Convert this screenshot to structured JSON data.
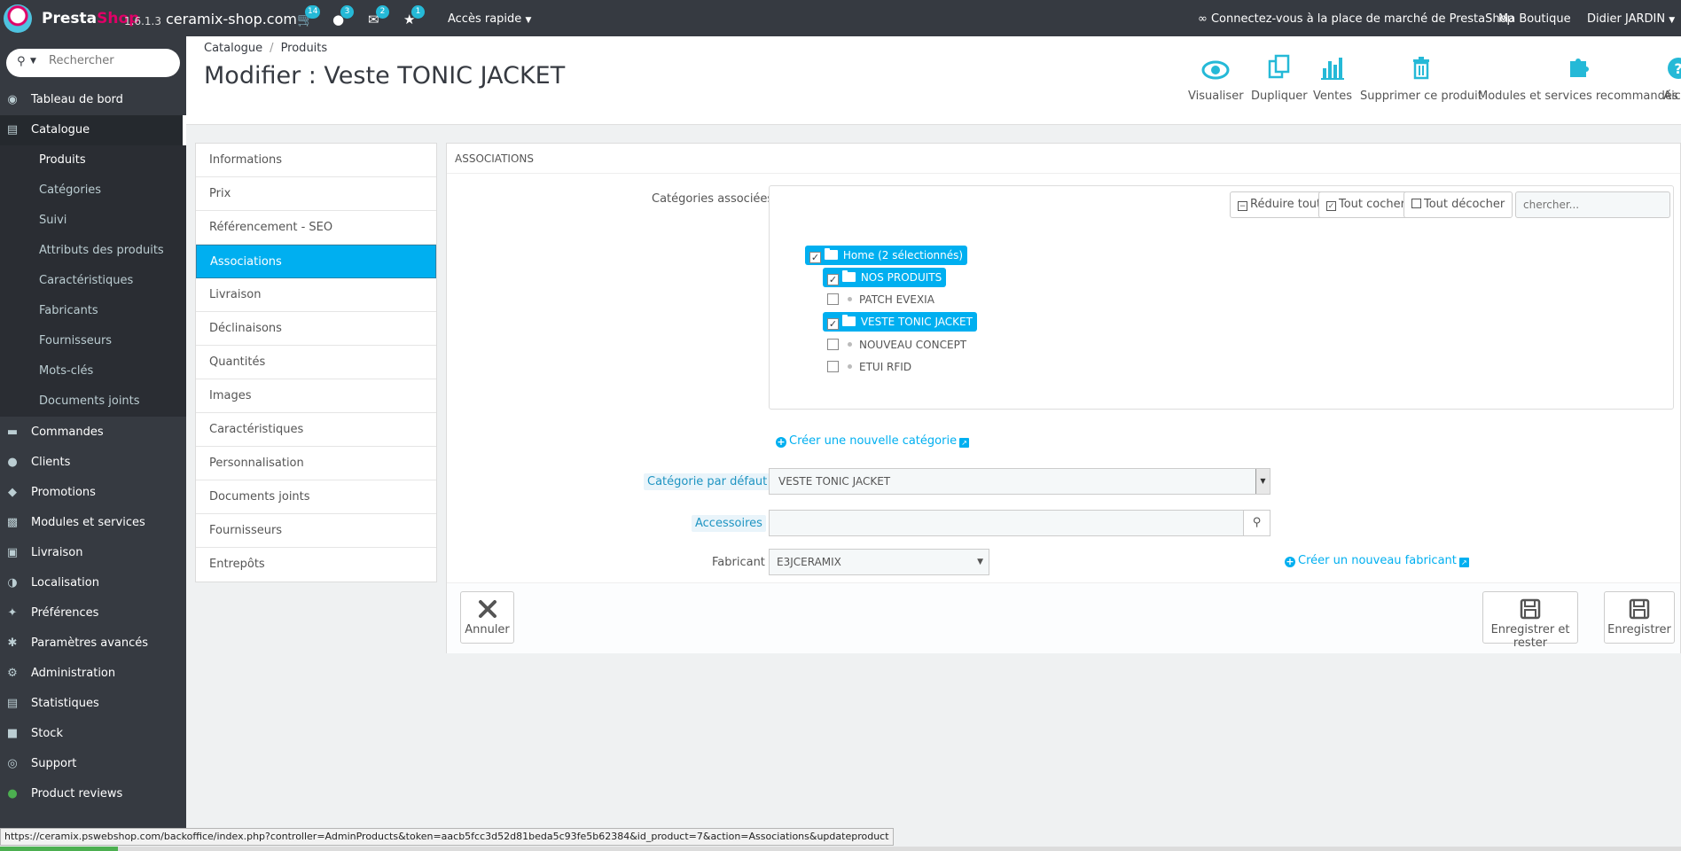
{
  "header": {
    "brand_a": "Presta",
    "brand_b": "Shop",
    "version": "1.6.1.3",
    "shop_name": "ceramix-shop.com",
    "notifications": [
      {
        "icon": "cart-icon",
        "count": "14"
      },
      {
        "icon": "user-icon",
        "count": "3"
      },
      {
        "icon": "envelope-icon",
        "count": "2"
      },
      {
        "icon": "trophy-icon",
        "count": "1"
      }
    ],
    "quick_access": "Accès rapide",
    "marketplace": "Connectez-vous à la place de marché de PrestaShop",
    "my_shop": "Ma Boutique",
    "user": "Didier JARDIN"
  },
  "sidebar": {
    "search_placeholder": "Rechercher",
    "items": [
      {
        "label": "Tableau de bord"
      },
      {
        "label": "Catalogue"
      },
      {
        "label": "Commandes"
      },
      {
        "label": "Clients"
      },
      {
        "label": "Promotions"
      },
      {
        "label": "Modules et services"
      },
      {
        "label": "Livraison"
      },
      {
        "label": "Localisation"
      },
      {
        "label": "Préférences"
      },
      {
        "label": "Paramètres avancés"
      },
      {
        "label": "Administration"
      },
      {
        "label": "Statistiques"
      },
      {
        "label": "Stock"
      },
      {
        "label": "Support"
      },
      {
        "label": "Product reviews"
      }
    ],
    "catalogue_sub": [
      {
        "label": "Produits"
      },
      {
        "label": "Catégories"
      },
      {
        "label": "Suivi"
      },
      {
        "label": "Attributs des produits"
      },
      {
        "label": "Caractéristiques"
      },
      {
        "label": "Fabricants"
      },
      {
        "label": "Fournisseurs"
      },
      {
        "label": "Mots-clés"
      },
      {
        "label": "Documents joints"
      }
    ]
  },
  "breadcrumb": {
    "root": "Catalogue",
    "current": "Produits"
  },
  "page_title": "Modifier : Veste TONIC JACKET",
  "toolbar": [
    {
      "label": "Visualiser"
    },
    {
      "label": "Dupliquer"
    },
    {
      "label": "Ventes"
    },
    {
      "label": "Supprimer ce produit"
    },
    {
      "label": "Modules et services recommandés"
    },
    {
      "label": "Aic"
    }
  ],
  "tabs": [
    {
      "label": "Informations"
    },
    {
      "label": "Prix"
    },
    {
      "label": "Référencement - SEO"
    },
    {
      "label": "Associations"
    },
    {
      "label": "Livraison"
    },
    {
      "label": "Déclinaisons"
    },
    {
      "label": "Quantités"
    },
    {
      "label": "Images"
    },
    {
      "label": "Caractéristiques"
    },
    {
      "label": "Personnalisation"
    },
    {
      "label": "Documents joints"
    },
    {
      "label": "Fournisseurs"
    },
    {
      "label": "Entrepôts"
    }
  ],
  "panel": {
    "heading": "Associations",
    "categories_label": "Catégories associées",
    "collapse_all": "Réduire tout",
    "check_all": "Tout cocher",
    "uncheck_all": "Tout décocher",
    "tree_search_placeholder": "chercher...",
    "tree": {
      "root": {
        "label": "Home (2 sélectionnés)",
        "checked": true
      },
      "nos_produits": {
        "label": "NOS PRODUITS",
        "checked": true
      },
      "patch_evexia": {
        "label": "PATCH EVEXIA",
        "checked": false
      },
      "veste": {
        "label": "VESTE TONIC JACKET",
        "checked": true
      },
      "nouveau_concept": {
        "label": "NOUVEAU CONCEPT",
        "checked": false
      },
      "etui_rfid": {
        "label": "ETUI RFID",
        "checked": false
      }
    },
    "create_category": "Créer une nouvelle catégorie",
    "default_category_label": "Catégorie par défaut",
    "default_category_value": "VESTE TONIC JACKET",
    "accessories_label": "Accessoires",
    "accessories_value": "",
    "manufacturer_label": "Fabricant",
    "manufacturer_value": "E3JCERAMIX",
    "create_manufacturer": "Créer un nouveau fabricant",
    "cancel": "Annuler",
    "save_stay": "Enregistrer et rester",
    "save": "Enregistrer"
  },
  "status_url": "https://ceramix.pswebshop.com/backoffice/index.php?controller=AdminProducts&token=aacb5fcc3d52d81beda5c93fe5b62384&id_product=7&action=Associations&updateproduct",
  "colors": {
    "accent": "#00aff0",
    "sidebar": "#363a41",
    "brand_pink": "#df0067"
  }
}
